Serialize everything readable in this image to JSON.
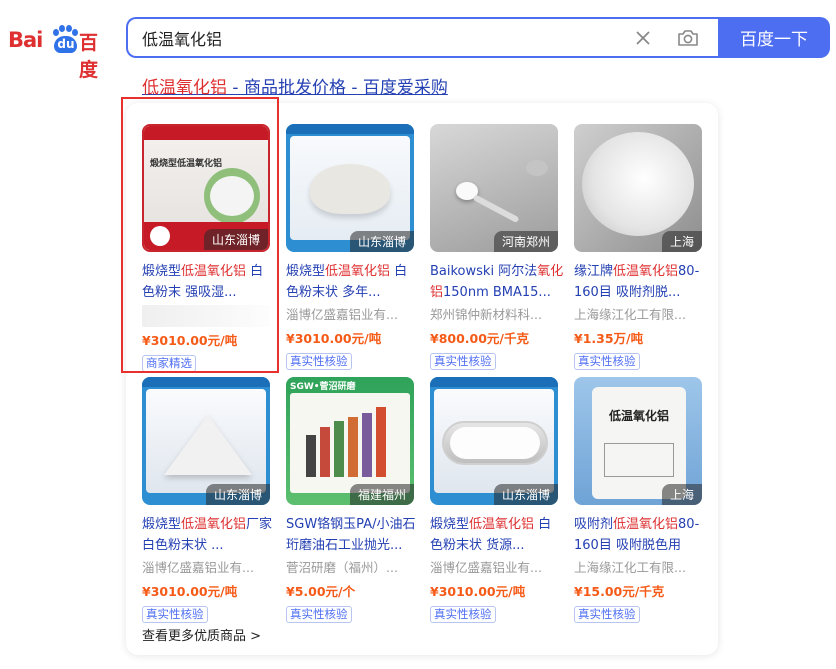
{
  "header": {
    "logo_bai": "Bai",
    "logo_du": "du",
    "logo_cn": "百度",
    "search_value": "低温氧化铝",
    "search_button": "百度一下"
  },
  "result": {
    "title_highlight": "低温氧化铝",
    "title_rest": " - 商品批发价格 - 百度爱采购"
  },
  "products": [
    {
      "name_pre": "煅烧型",
      "name_hl": "低温氧化铝",
      "name_post": " 白色粉末 强吸湿...",
      "location": "山东淄博",
      "seller": "",
      "price": "¥3010.00元/吨",
      "tag": "商家精选",
      "image_caption": "煅烧型低温氧化铝"
    },
    {
      "name_pre": "煅烧型",
      "name_hl": "低温氧化铝",
      "name_post": " 白色粉末状 多年...",
      "location": "山东淄博",
      "seller": "淄博亿盛嘉铝业有...",
      "price": "¥3010.00元/吨",
      "tag": "真实性核验"
    },
    {
      "name_pre": "Baikowski 阿尔法",
      "name_hl": "氧化铝",
      "name_post": "150nm BMA15...",
      "location": "河南郑州",
      "seller": "郑州锦仲新材料科...",
      "price": "¥800.00元/千克",
      "tag": "真实性核验"
    },
    {
      "name_pre": "缘江牌",
      "name_hl": "低温氧化铝",
      "name_post": "80-160目 吸附剂脱...",
      "location": "上海",
      "seller": "上海缘江化工有限...",
      "price": "¥1.35万/吨",
      "tag": "真实性核验"
    },
    {
      "name_pre": "煅烧型",
      "name_hl": "低温氧化铝",
      "name_post": "厂家 白色粉末状 ...",
      "location": "山东淄博",
      "seller": "淄博亿盛嘉铝业有...",
      "price": "¥3010.00元/吨",
      "tag": "真实性核验"
    },
    {
      "name_pre": "SGW铬钢玉PA/小油石珩磨油石工业抛光...",
      "name_hl": "",
      "name_post": "",
      "location": "福建福州",
      "seller": "菅沼研磨（福州）...",
      "price": "¥5.00元/个",
      "tag": "真实性核验",
      "image_caption": "SGW•菅沼研磨"
    },
    {
      "name_pre": "煅烧型",
      "name_hl": "低温氧化铝",
      "name_post": " 白色粉末状 货源...",
      "location": "山东淄博",
      "seller": "淄博亿盛嘉铝业有...",
      "price": "¥3010.00元/吨",
      "tag": "真实性核验"
    },
    {
      "name_pre": "吸附剂",
      "name_hl": "低温氧化铝",
      "name_post": "80-160目 吸附脱色用",
      "location": "上海",
      "seller": "上海缘江化工有限...",
      "price": "¥15.00元/千克",
      "tag": "真实性核验",
      "image_caption": "低温氧化铝"
    }
  ],
  "more_link": "查看更多优质商品 >",
  "colors": {
    "brand_blue": "#4e6ef2",
    "link_blue": "#2440b3",
    "highlight_red": "#de3031",
    "price_orange": "#f55a17"
  }
}
